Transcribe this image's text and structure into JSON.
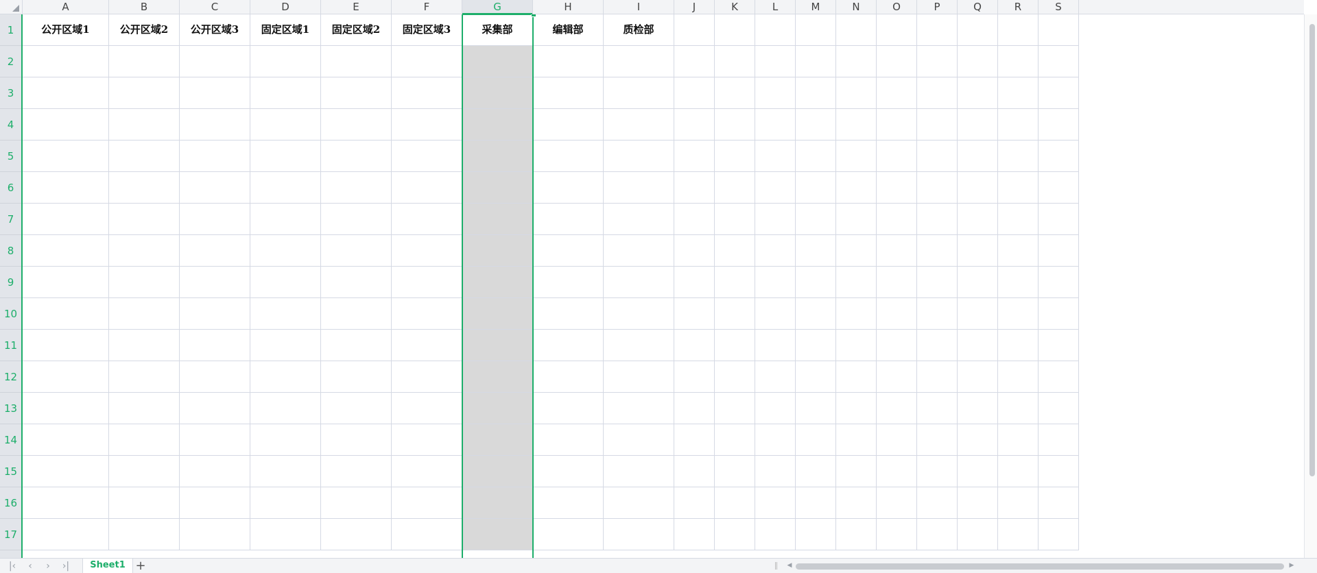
{
  "sheet": {
    "columns": [
      "A",
      "B",
      "C",
      "D",
      "E",
      "F",
      "G",
      "H",
      "I",
      "J",
      "K",
      "L",
      "M",
      "N",
      "O",
      "P",
      "Q",
      "R",
      "S"
    ],
    "rows": [
      "1",
      "2",
      "3",
      "4",
      "5",
      "6",
      "7",
      "8",
      "9",
      "10",
      "11",
      "12",
      "13",
      "14",
      "15",
      "16",
      "17"
    ],
    "header_row": [
      "公开区域1",
      "公开区域2",
      "公开区域3",
      "固定区域1",
      "固定区域2",
      "固定区域3",
      "采集部",
      "编辑部",
      "质检部",
      "",
      "",
      "",
      "",
      "",
      "",
      "",
      "",
      "",
      ""
    ],
    "selected_column": "G",
    "accent_color": "#1dae6a"
  },
  "tabs": {
    "items": [
      "Sheet1"
    ],
    "add_icon": "plus-icon"
  },
  "nav": {
    "icons": [
      "first-sheet-icon",
      "prev-sheet-icon",
      "next-sheet-icon",
      "last-sheet-icon"
    ]
  }
}
